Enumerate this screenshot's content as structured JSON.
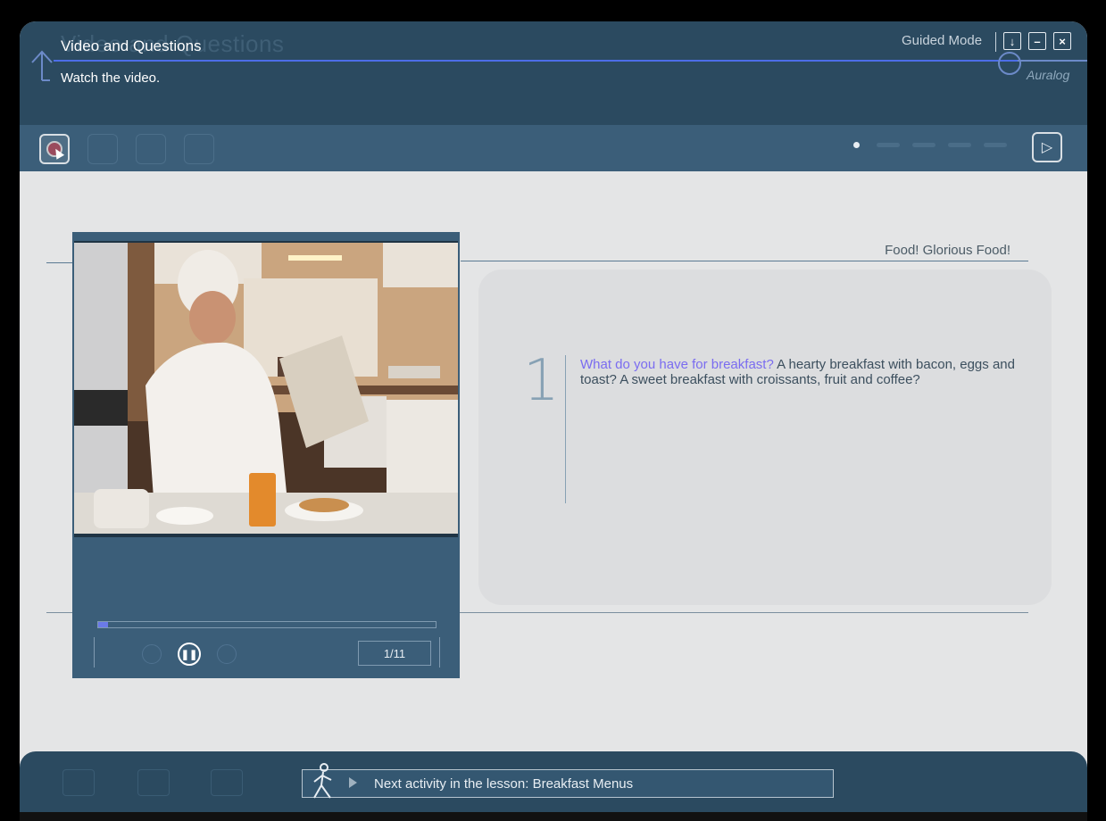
{
  "header": {
    "title": "Video and Questions",
    "subtitle": "Watch the video.",
    "mode": "Guided Mode",
    "brand": "Auralog",
    "window_buttons": [
      "download-icon",
      "minimize-icon",
      "close-icon"
    ]
  },
  "toolbar": {
    "tools": [
      "record-icon",
      "tool-2-icon",
      "tool-3-icon",
      "tool-4-icon"
    ],
    "next_icon": "next-icon"
  },
  "content": {
    "topic": "Food! Glorious Food!",
    "video": {
      "counter": "1/11",
      "progress": 0.03
    },
    "question": {
      "number": "1",
      "highlight": "What do you have for breakfast?",
      "text": " A hearty breakfast with bacon, eggs and toast? A sweet breakfast with croissants, fruit and coffee?"
    }
  },
  "footer": {
    "next_activity": "Next activity in the lesson: Breakfast Menus"
  },
  "colors": {
    "header_bg": "#2b4a60",
    "toolbar_bg": "#3b5e79",
    "highlight": "#7a6cf0",
    "content_bg": "#e4e5e6"
  }
}
